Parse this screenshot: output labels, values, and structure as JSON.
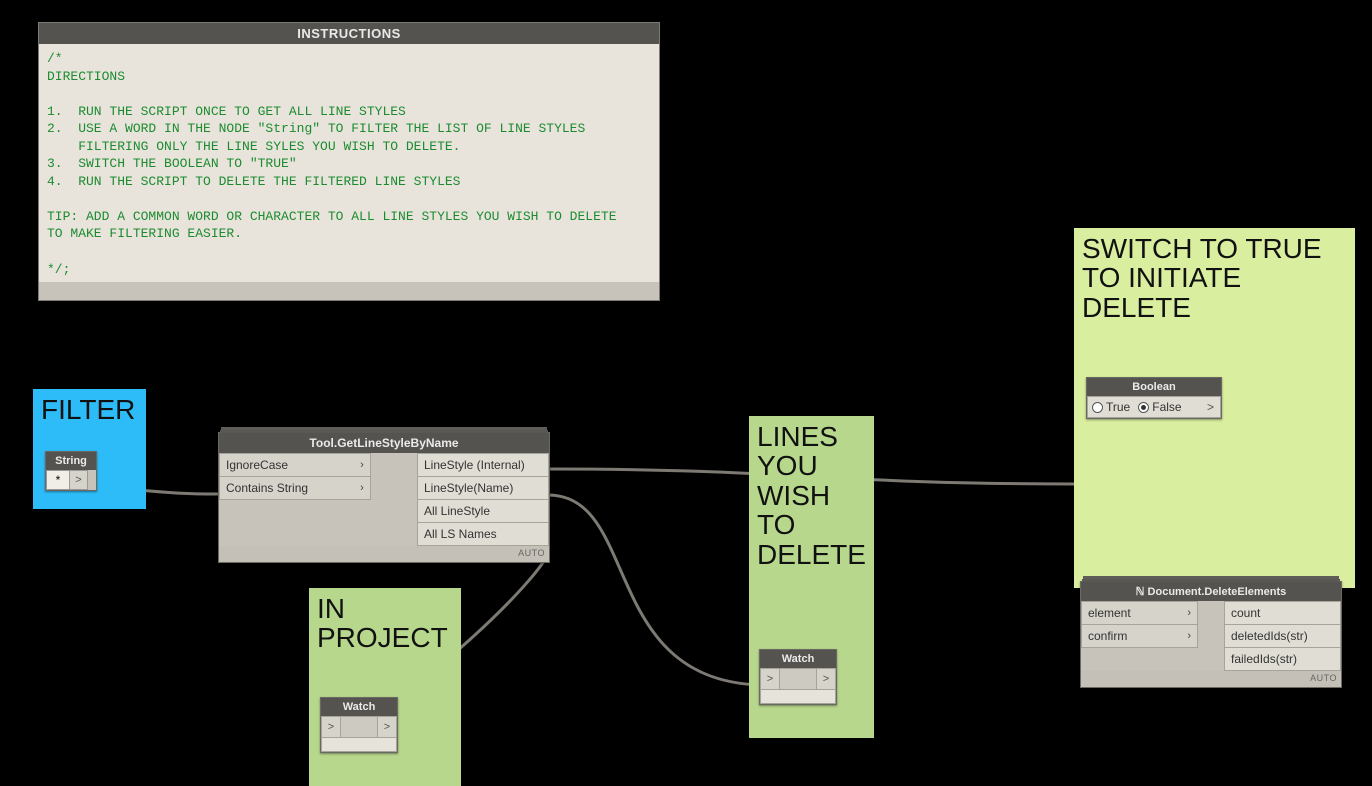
{
  "instructions": {
    "title": "INSTRUCTIONS",
    "body": "/*\nDIRECTIONS\n\n1.  RUN THE SCRIPT ONCE TO GET ALL LINE STYLES\n2.  USE A WORD IN THE NODE \"String\" TO FILTER THE LIST OF LINE STYLES\n    FILTERING ONLY THE LINE SYLES YOU WISH TO DELETE.\n3.  SWITCH THE BOOLEAN TO \"TRUE\"\n4.  RUN THE SCRIPT TO DELETE THE FILTERED LINE STYLES\n\nTIP: ADD A COMMON WORD OR CHARACTER TO ALL LINE STYLES YOU WISH TO DELETE\nTO MAKE FILTERING EASIER.\n\n*/;"
  },
  "groups": {
    "filter": "FILTER",
    "in_project": "IN\nPROJECT",
    "lines_delete": "LINES\nYOU\nWISH\nTO\nDELETE",
    "switch_delete": "SWITCH TO TRUE\nTO INITIATE\nDELETE"
  },
  "string_node": {
    "title": "String",
    "value": "*",
    "out": ">"
  },
  "getls_node": {
    "title": "Tool.GetLineStyleByName",
    "inputs": [
      "IgnoreCase",
      "Contains String"
    ],
    "outputs": [
      "LineStyle (Internal)",
      "LineStyle(Name)",
      "All LineStyle",
      "All LS Names"
    ],
    "footer": "AUTO"
  },
  "watch1": {
    "title": "Watch",
    "in": ">",
    "out": ">"
  },
  "watch2": {
    "title": "Watch",
    "in": ">",
    "out": ">"
  },
  "bool_node": {
    "title": "Boolean",
    "true_label": "True",
    "false_label": "False",
    "selected": "False",
    "out": ">"
  },
  "delete_node": {
    "title": "ℕ Document.DeleteElements",
    "inputs": [
      "element",
      "confirm"
    ],
    "outputs": [
      "count",
      "deletedIds(str)",
      "failedIds(str)"
    ],
    "footer": "AUTO"
  }
}
